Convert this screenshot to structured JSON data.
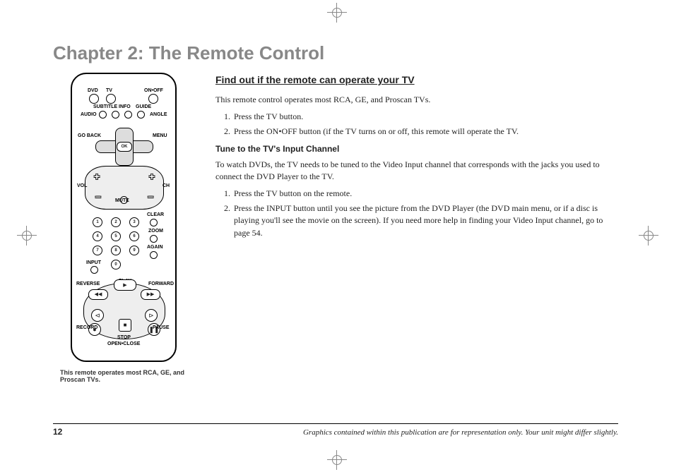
{
  "chapter_title": "Chapter 2: The Remote Control",
  "page_number": "12",
  "footnote": "Graphics contained within this publication are for representation only. Your unit might differ slightly.",
  "figure_caption": "This remote operates most RCA, GE, and Proscan TVs.",
  "remote": {
    "labels": {
      "dvd": "DVD",
      "tv": "TV",
      "onoff": "ON•OFF",
      "subtitle": "SUBTITLE",
      "info": "INFO",
      "guide": "GUIDE",
      "audio": "AUDIO",
      "angle": "ANGLE",
      "goback": "GO BACK",
      "menu": "MENU",
      "ok": "OK",
      "vol": "VOL",
      "mute": "MUTE",
      "ch": "CH",
      "clear": "CLEAR",
      "zoom": "ZOOM",
      "again": "AGAIN",
      "input": "INPUT",
      "reverse": "REVERSE",
      "play": "PLAY",
      "forward": "FORWARD",
      "record": "RECORD",
      "pause": "PAUSE",
      "stop": "STOP",
      "openclose": "OPEN•CLOSE"
    },
    "digits": [
      "1",
      "2",
      "3",
      "4",
      "5",
      "6",
      "7",
      "8",
      "9",
      "0"
    ]
  },
  "content": {
    "h1": "Find out if the remote can operate your TV",
    "intro": "This remote control operates most RCA, GE, and Proscan TVs.",
    "steps1": {
      "s1": "Press the TV button.",
      "s2": "Press the ON•OFF button (if the TV turns on or off, this remote will operate the TV."
    },
    "h2": "Tune to the TV's Input Channel",
    "para2": "To watch DVDs, the TV needs to be tuned to the Video Input channel that corresponds with the jacks you used to connect the DVD Player to the TV.",
    "steps2": {
      "s1": "Press the TV button on the remote.",
      "s2": "Press the INPUT button until you see the picture from the DVD Player (the DVD main menu, or if a disc is playing you'll see the movie on the screen). If you need more help in finding your Video Input channel, go to page 54."
    }
  }
}
